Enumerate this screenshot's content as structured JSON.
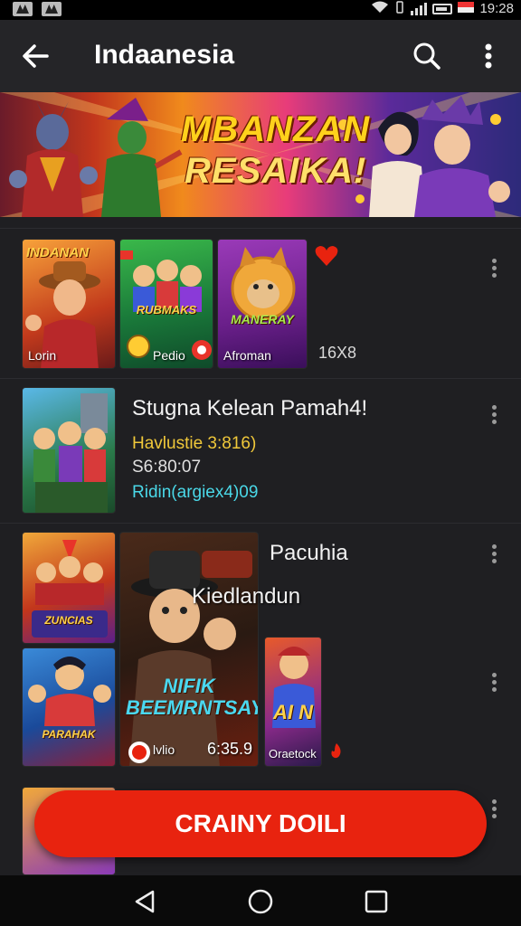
{
  "status_bar": {
    "time": "19:28",
    "icons": [
      "wifi-icon",
      "signal-icon",
      "battery-icon"
    ]
  },
  "app_bar": {
    "title": "Indaanesia",
    "back_icon": "arrow-left-icon",
    "search_icon": "search-icon",
    "more_icon": "more-vert-icon"
  },
  "banner": {
    "title_line1": "MBANZAN",
    "title_line2": "RESAIKA!"
  },
  "rows": [
    {
      "thumbnails": [
        {
          "top_text": "INDANAN",
          "label": "Lorin"
        },
        {
          "center_text": "RUBMAKS",
          "label": "Pedio"
        },
        {
          "center_text": "MANERAY",
          "label": "Afroman"
        }
      ],
      "meta": "16X8"
    },
    {
      "title": "Stugna Kelean Pamah4!",
      "line1": "Havlustie 3:816)",
      "line2": "S6:80:07",
      "line3": "Ridin(argiex4)09"
    },
    {
      "title": "Pacuhia",
      "subtitle": "Kiedlandun",
      "thumbnails": [
        {
          "center_text": "ZUNCIAS"
        },
        {
          "center_text": "PARAHAK"
        },
        {
          "center_text": "NIFIK BEEMRNTSAY",
          "badge": "lvlio",
          "duration": "6:35.9"
        },
        {
          "center_text": "AI N",
          "label": "Oraetock"
        }
      ]
    }
  ],
  "fab": {
    "label": "CRAINY DOILI"
  },
  "colors": {
    "accent": "#e8230f",
    "background": "#1f1f22",
    "appbar": "#252528"
  }
}
